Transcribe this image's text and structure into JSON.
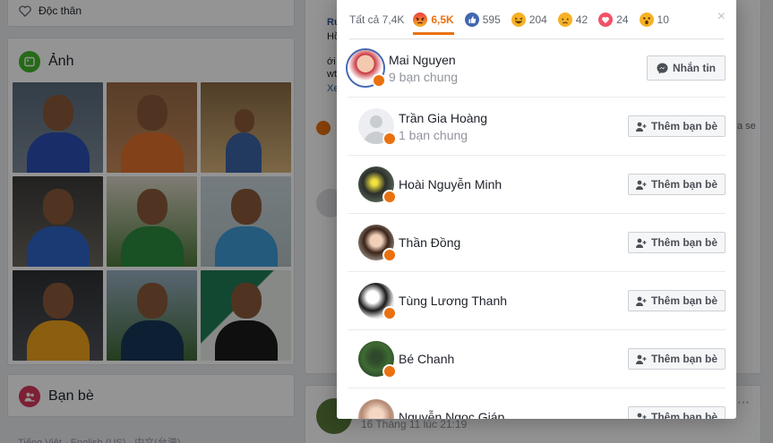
{
  "background": {
    "intro_text": "Độc thân",
    "photos_title": "Ảnh",
    "friends_title": "Bạn bè",
    "language_line": "Tiếng Việt · English (US) · 中文(台灣)",
    "post_snippets": [
      "Ru",
      "Hồ",
      "ới",
      "wt",
      "Xe",
      "a se"
    ],
    "post2_timestamp": "16 Tháng 11 lúc 21:19"
  },
  "modal": {
    "tabs": [
      {
        "label": "Tất cả 7,4K",
        "icon": ""
      },
      {
        "label": "6,5K",
        "icon": "angry-reaction-icon"
      },
      {
        "label": "595",
        "icon": "like-reaction-icon"
      },
      {
        "label": "204",
        "icon": "haha-reaction-icon"
      },
      {
        "label": "42",
        "icon": "sad-reaction-icon"
      },
      {
        "label": "24",
        "icon": "love-reaction-icon"
      },
      {
        "label": "10",
        "icon": "wow-reaction-icon"
      }
    ],
    "close_label": "×",
    "people": [
      {
        "name": "Mai Nguyen",
        "mutual": "9 bạn chung",
        "button": "Nhắn tin"
      },
      {
        "name": "Trần Gia Hoàng",
        "mutual": "1 bạn chung",
        "button": "Thêm bạn bè"
      },
      {
        "name": "Hoài Nguyễn Minh",
        "mutual": "",
        "button": "Thêm bạn bè"
      },
      {
        "name": "Thần Đồng",
        "mutual": "",
        "button": "Thêm bạn bè"
      },
      {
        "name": "Tùng Lương Thanh",
        "mutual": "",
        "button": "Thêm bạn bè"
      },
      {
        "name": "Bé Chanh",
        "mutual": "",
        "button": "Thêm bạn bè"
      },
      {
        "name": "Nguyễn Ngọc Giáp",
        "mutual": "",
        "button": "Thêm bạn bè"
      }
    ]
  },
  "colors": {
    "angry": "#e9710f",
    "like": "#4267b2",
    "haha": "#f7b125",
    "love": "#f25268"
  }
}
